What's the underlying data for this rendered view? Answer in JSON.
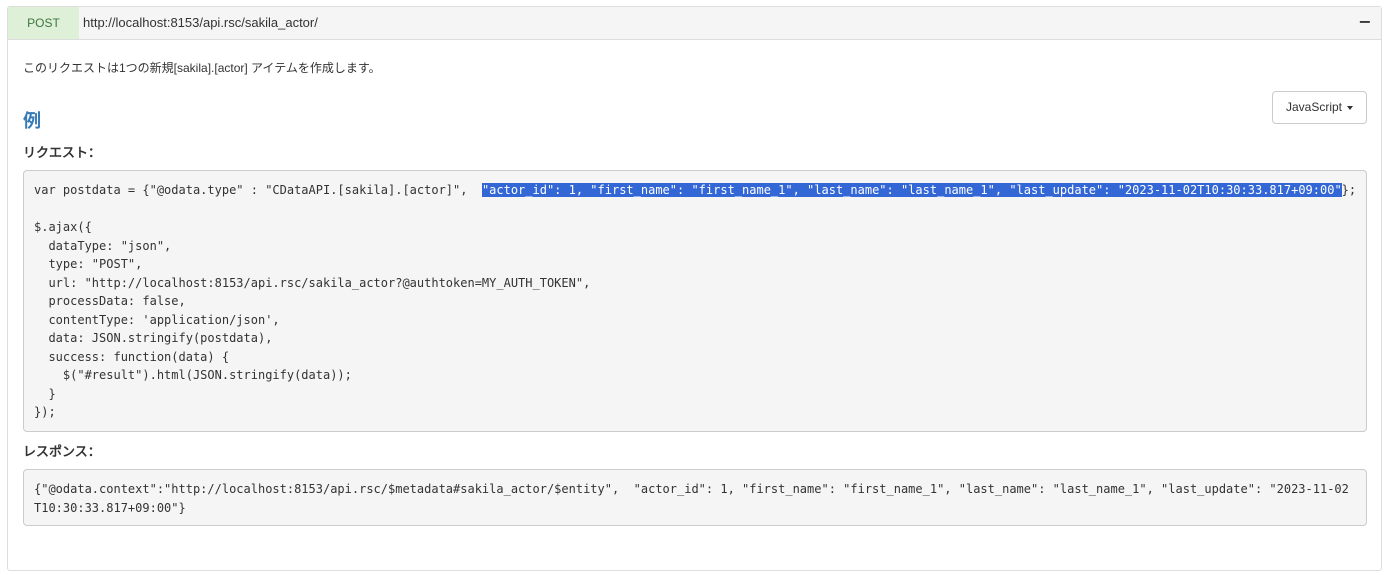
{
  "header": {
    "method": "POST",
    "url": "http://localhost:8153/api.rsc/sakila_actor/",
    "collapse_icon": "minus-icon"
  },
  "description": "このリクエストは1つの新規[sakila].[actor] アイテムを作成します。",
  "language_selector": {
    "selected": "JavaScript",
    "icon": "caret-down-icon"
  },
  "example_heading": "例",
  "request": {
    "label": "リクエスト：",
    "line1_prefix": "var postdata = {\"@odata.type\" : \"CDataAPI.[sakila].[actor]\",  ",
    "line1_selected": "\"actor_id\": 1, \"first_name\": \"first_name_1\", \"last_name\": \"last_name_1\", \"last_update\": \"2023-11-02T10:30:33.817+09:00\"",
    "line1_suffix": "};",
    "body": "$.ajax({\n  dataType: \"json\",\n  type: \"POST\",\n  url: \"http://localhost:8153/api.rsc/sakila_actor?@authtoken=MY_AUTH_TOKEN\",\n  processData: false,\n  contentType: 'application/json',\n  data: JSON.stringify(postdata),\n  success: function(data) {\n    $(\"#result\").html(JSON.stringify(data));\n  }\n});"
  },
  "response": {
    "label": "レスポンス：",
    "code": "{\"@odata.context\":\"http://localhost:8153/api.rsc/$metadata#sakila_actor/$entity\",  \"actor_id\": 1, \"first_name\": \"first_name_1\", \"last_name\": \"last_name_1\", \"last_update\": \"2023-11-02T10:30:33.817+09:00\"}"
  }
}
